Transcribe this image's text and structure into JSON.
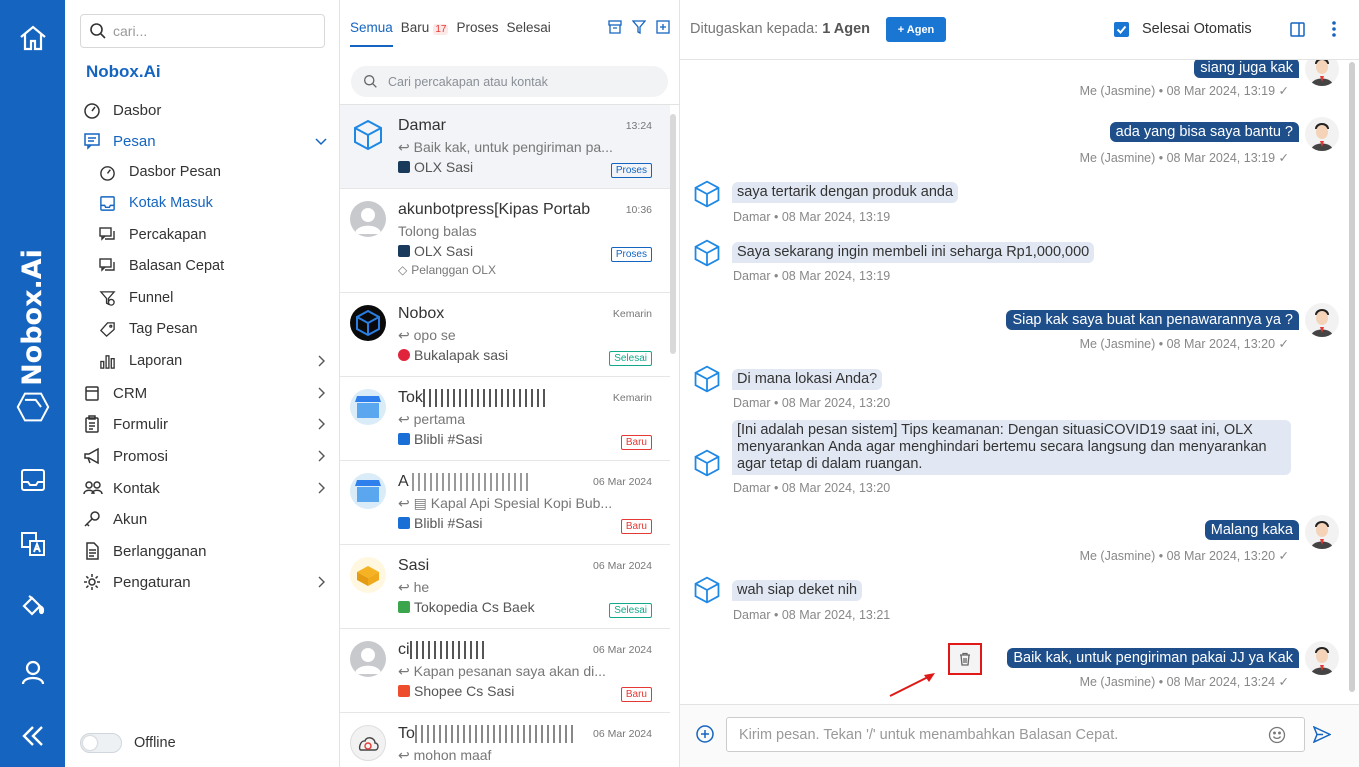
{
  "rail": {
    "brand": "Nobox.Ai"
  },
  "menu": {
    "search_placeholder": "cari...",
    "brand": "Nobox.Ai",
    "items": [
      {
        "label": "Dasbor"
      },
      {
        "label": "Pesan"
      },
      {
        "label": "Dasbor Pesan"
      },
      {
        "label": "Kotak Masuk"
      },
      {
        "label": "Percakapan"
      },
      {
        "label": "Balasan Cepat"
      },
      {
        "label": "Funnel"
      },
      {
        "label": "Tag Pesan"
      },
      {
        "label": "Laporan"
      },
      {
        "label": "CRM"
      },
      {
        "label": "Formulir"
      },
      {
        "label": "Promosi"
      },
      {
        "label": "Kontak"
      },
      {
        "label": "Akun"
      },
      {
        "label": "Berlangganan"
      },
      {
        "label": "Pengaturan"
      }
    ],
    "offline_label": "Offline"
  },
  "conversations": {
    "tabs": [
      "Semua",
      "Baru",
      "Proses",
      "Selesai"
    ],
    "new_count": "17",
    "search_placeholder": "Cari percakapan atau kontak",
    "items": [
      {
        "name": "Damar",
        "time": "13:24",
        "preview": "Baik kak, untuk pengiriman pa...",
        "channel": "OLX Sasi",
        "status": "Proses"
      },
      {
        "name": "akunbotpress[Kipas Portab",
        "time": "10:36",
        "preview": "Tolong balas",
        "channel": "OLX Sasi",
        "tag": "Pelanggan OLX",
        "status": "Proses"
      },
      {
        "name": "Nobox",
        "time": "Kemarin",
        "preview": "opo se",
        "channel": "Bukalapak sasi",
        "status": "Selesai"
      },
      {
        "name": "Tok",
        "time": "Kemarin",
        "preview": "pertama",
        "channel": "Blibli #Sasi",
        "status": "Baru"
      },
      {
        "name": "A",
        "time": "06 Mar 2024",
        "preview": "Kapal Api Spesial Kopi Bub...",
        "channel": "Blibli #Sasi",
        "status": "Baru"
      },
      {
        "name": "Sasi",
        "time": "06 Mar 2024",
        "preview": "he",
        "channel": "Tokopedia Cs Baek",
        "status": "Selesai"
      },
      {
        "name": "ci",
        "time": "06 Mar 2024",
        "preview": "Kapan pesanan saya akan di...",
        "channel": "Shopee Cs Sasi",
        "status": "Baru"
      },
      {
        "name": "To",
        "time": "06 Mar 2024",
        "preview": "mohon maaf"
      }
    ]
  },
  "chat": {
    "assigned_label": "Ditugaskan kepada:",
    "assigned_value": "1 Agen",
    "add_agent_label": "+ Agen",
    "auto_finish_label": "Selesai Otomatis",
    "messages": [
      {
        "text": "siang juga kak",
        "meta": "Me (Jasmine) • 08 Mar 2024, 13:19"
      },
      {
        "text": "ada yang bisa saya bantu ?",
        "meta": "Me (Jasmine) • 08 Mar 2024, 13:19"
      },
      {
        "text": "saya tertarik dengan produk anda",
        "meta": "Damar • 08 Mar 2024, 13:19"
      },
      {
        "text": "Saya sekarang ingin membeli ini seharga Rp1,000,000",
        "meta": "Damar • 08 Mar 2024, 13:19"
      },
      {
        "text": "Siap kak saya buat kan penawarannya ya ?",
        "meta": "Me (Jasmine) • 08 Mar 2024, 13:20"
      },
      {
        "text": "Di mana lokasi Anda?",
        "meta": "Damar • 08 Mar 2024, 13:20"
      },
      {
        "text": "[Ini adalah pesan sistem] Tips keamanan: Dengan situasiCOVID19 saat ini, OLX menyarankan Anda agar menghindari bertemu secara langsung dan menyarankan agar tetap di dalam ruangan.",
        "meta": "Damar • 08 Mar 2024, 13:20"
      },
      {
        "text": "Malang kaka",
        "meta": "Me (Jasmine) • 08 Mar 2024, 13:20"
      },
      {
        "text": "wah siap deket nih",
        "meta": "Damar • 08 Mar 2024, 13:21"
      },
      {
        "text": "Baik kak, untuk pengiriman pakai JJ ya Kak",
        "meta": "Me (Jasmine) • 08 Mar 2024, 13:24"
      }
    ],
    "composer_placeholder": "Kirim pesan. Tekan '/' untuk menambahkan Balasan Cepat."
  },
  "colors": {
    "primary": "#1565c0",
    "bubble_out": "#1e4f8a",
    "bubble_in": "#e1e8f3",
    "highlight": "#e01818"
  }
}
